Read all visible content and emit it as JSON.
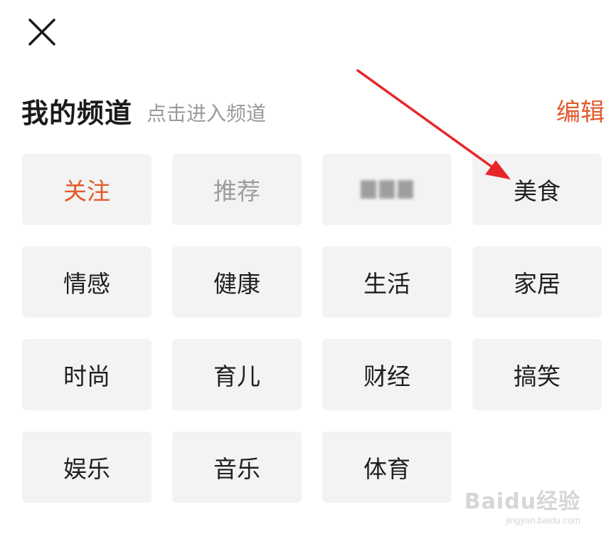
{
  "header": {
    "title": "我的频道",
    "subtitle": "点击进入频道",
    "edit_label": "编辑"
  },
  "channels": [
    {
      "label": "关注",
      "state": "active"
    },
    {
      "label": "推荐",
      "state": "muted"
    },
    {
      "label": "",
      "state": "redacted"
    },
    {
      "label": "美食",
      "state": "normal"
    },
    {
      "label": "情感",
      "state": "normal"
    },
    {
      "label": "健康",
      "state": "normal"
    },
    {
      "label": "生活",
      "state": "normal"
    },
    {
      "label": "家居",
      "state": "normal"
    },
    {
      "label": "时尚",
      "state": "normal"
    },
    {
      "label": "育儿",
      "state": "normal"
    },
    {
      "label": "财经",
      "state": "normal"
    },
    {
      "label": "搞笑",
      "state": "normal"
    },
    {
      "label": "娱乐",
      "state": "normal"
    },
    {
      "label": "音乐",
      "state": "normal"
    },
    {
      "label": "体育",
      "state": "normal"
    }
  ],
  "colors": {
    "accent": "#e25a2c",
    "annotation_arrow": "#e8262a"
  },
  "icons": {
    "close": "close-icon"
  },
  "watermark": {
    "main": "Baidu经验",
    "sub": "jingyan.baidu.com"
  }
}
